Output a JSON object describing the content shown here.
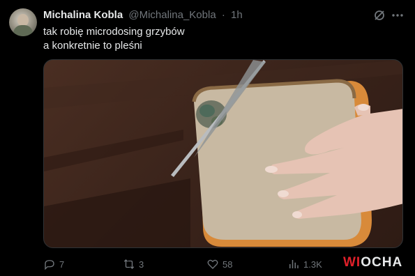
{
  "tweet": {
    "display_name": "Michalina Kobla",
    "handle": "@Michalina_Kobla",
    "separator": "·",
    "time": "1h",
    "text_line1": "tak robię microdosing grzybów",
    "text_line2": "a konkretnie to pleśni"
  },
  "icons": {
    "grok": "grok-icon",
    "more": "more-icon"
  },
  "media": {
    "description_icon": "video-frame"
  },
  "actions": {
    "replies": "7",
    "reposts": "3",
    "likes": "58",
    "views": "1.3K"
  },
  "watermark": {
    "part1": "WI",
    "part2": "OCHA"
  },
  "colors": {
    "background": "#000000",
    "text": "#e7e9ea",
    "muted": "#71767b",
    "watermark_red": "#e0202a"
  }
}
